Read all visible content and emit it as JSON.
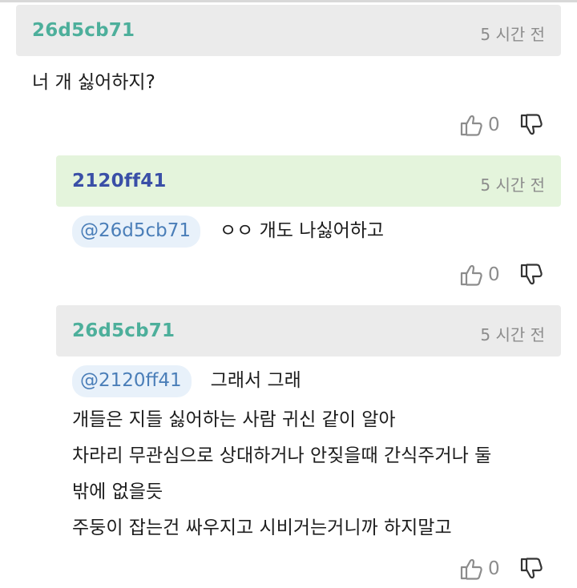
{
  "comments": [
    {
      "author": "26d5cb71",
      "time": "5 시간 전",
      "lines": [
        "너 개 싫어하지?"
      ],
      "likes": "0"
    },
    {
      "author": "2120ff41",
      "time": "5 시간 전",
      "mention": "@26d5cb71",
      "lines": [
        "ㅇㅇ 개도 나싫어하고"
      ],
      "likes": "0"
    },
    {
      "author": "26d5cb71",
      "time": "5 시간 전",
      "mention": "@2120ff41",
      "first_line": "그래서 그래",
      "lines": [
        "개들은 지들 싫어하는 사람 귀신 같이 알아",
        "차라리 무관심으로 상대하거나 안짖을때 간식주거나 둘",
        "밖에 없을듯",
        "주둥이 잡는건 싸우지고 시비거는거니까 하지말고"
      ],
      "likes": "0"
    }
  ],
  "icons": {
    "like": "thumbs-up-icon",
    "dislike": "thumbs-down-icon"
  },
  "colors": {
    "author_teal": "#4daf9b",
    "author_blue": "#3a4fa7",
    "header_gray": "#ebebeb",
    "header_green": "#e4f4dc",
    "mention_bg": "#e8f1fa",
    "mention_text": "#4a7eb8"
  }
}
